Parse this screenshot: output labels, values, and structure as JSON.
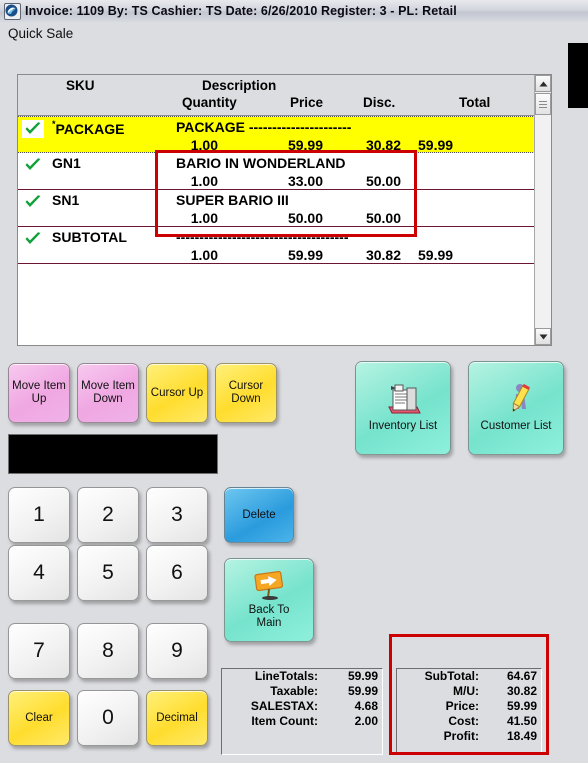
{
  "titlebar": {
    "icon": "app-icon",
    "text": "Invoice: 1109  By: TS  Cashier: TS   Date:  6/26/2010  Register: 3 - PL: Retail"
  },
  "form": {
    "caption": "Quick Sale"
  },
  "grid": {
    "headers": {
      "sku": "SKU",
      "description": "Description",
      "quantity": "Quantity",
      "price": "Price",
      "disc": "Disc.",
      "total": "Total"
    },
    "rows": [
      {
        "check": "check-icon",
        "sku_asterisk": "*",
        "sku": "PACKAGE",
        "description": "PACKAGE ----------------------",
        "quantity": "1.00",
        "price": "59.99",
        "disc": "30.82",
        "total": "59.99",
        "highlight": "yellow"
      },
      {
        "check": "check-icon",
        "sku_asterisk": "",
        "sku": "GN1",
        "description": "BARIO IN WONDERLAND",
        "quantity": "1.00",
        "price": "33.00",
        "disc": "50.00",
        "total": "",
        "highlight": "none"
      },
      {
        "check": "check-icon",
        "sku_asterisk": "",
        "sku": "SN1",
        "description": "SUPER BARIO III",
        "quantity": "1.00",
        "price": "50.00",
        "disc": "50.00",
        "total": "",
        "highlight": "none"
      },
      {
        "check": "check-icon",
        "sku_asterisk": "",
        "sku": "SUBTOTAL",
        "description": "-------------------------------------",
        "quantity": "1.00",
        "price": "59.99",
        "disc": "30.82",
        "total": "59.99",
        "highlight": "none"
      }
    ]
  },
  "scrollbar": {
    "up": "scroll-up-arrow-icon",
    "down": "scroll-down-arrow-icon"
  },
  "toolbar": {
    "move_item_up": "Move Item\nUp",
    "move_item_down": "Move Item\nDown",
    "cursor_up": "Cursor Up",
    "cursor_down": "Cursor\nDown",
    "inventory_list": "Inventory List",
    "customer_list": "Customer List"
  },
  "keypad": {
    "display_value": "",
    "keys": [
      "1",
      "2",
      "3",
      "4",
      "5",
      "6",
      "7",
      "8",
      "9"
    ],
    "zero": "0",
    "clear": "Clear",
    "decimal": "Decimal",
    "delete": "Delete",
    "back_to_main": "Back To\nMain"
  },
  "totals_left": {
    "rows": [
      {
        "label": "LineTotals:",
        "value": "59.99"
      },
      {
        "label": "Taxable:",
        "value": "59.99"
      },
      {
        "label": "SALESTAX:",
        "value": "4.68"
      },
      {
        "label": "Item Count:",
        "value": "2.00"
      }
    ]
  },
  "totals_right": {
    "rows": [
      {
        "label": "SubTotal:",
        "value": "64.67"
      },
      {
        "label": "M/U:",
        "value": "30.82"
      },
      {
        "label": "Price:",
        "value": "59.99"
      },
      {
        "label": "Cost:",
        "value": "41.50"
      },
      {
        "label": "Profit:",
        "value": "18.49"
      }
    ]
  },
  "annotations": {
    "items_box_color": "#cc0000",
    "totals_box_color": "#cc0000"
  }
}
